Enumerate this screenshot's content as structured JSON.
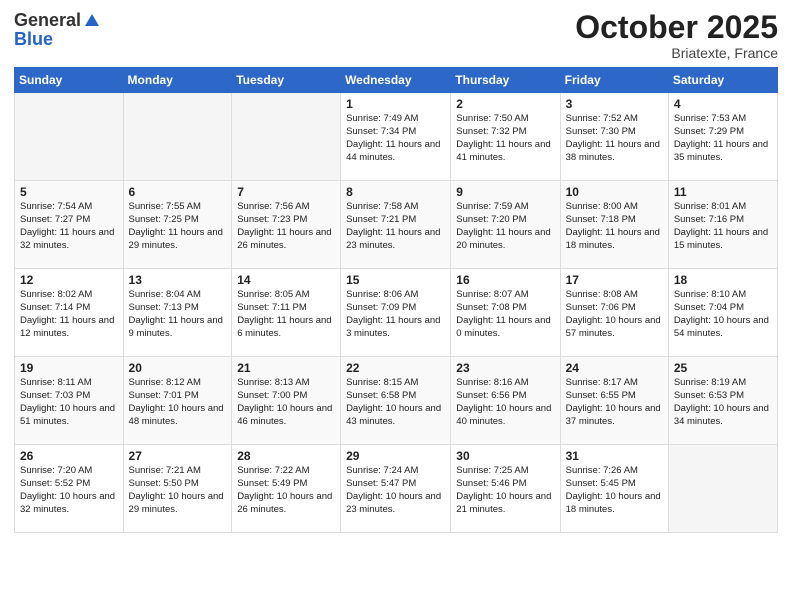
{
  "header": {
    "logo_general": "General",
    "logo_blue": "Blue",
    "month_title": "October 2025",
    "location": "Briatexte, France"
  },
  "days_of_week": [
    "Sunday",
    "Monday",
    "Tuesday",
    "Wednesday",
    "Thursday",
    "Friday",
    "Saturday"
  ],
  "weeks": [
    [
      {
        "day": "",
        "empty": true
      },
      {
        "day": "",
        "empty": true
      },
      {
        "day": "",
        "empty": true
      },
      {
        "day": "1",
        "sunrise": "7:49 AM",
        "sunset": "7:34 PM",
        "daylight": "11 hours and 44 minutes."
      },
      {
        "day": "2",
        "sunrise": "7:50 AM",
        "sunset": "7:32 PM",
        "daylight": "11 hours and 41 minutes."
      },
      {
        "day": "3",
        "sunrise": "7:52 AM",
        "sunset": "7:30 PM",
        "daylight": "11 hours and 38 minutes."
      },
      {
        "day": "4",
        "sunrise": "7:53 AM",
        "sunset": "7:29 PM",
        "daylight": "11 hours and 35 minutes."
      }
    ],
    [
      {
        "day": "5",
        "sunrise": "7:54 AM",
        "sunset": "7:27 PM",
        "daylight": "11 hours and 32 minutes."
      },
      {
        "day": "6",
        "sunrise": "7:55 AM",
        "sunset": "7:25 PM",
        "daylight": "11 hours and 29 minutes."
      },
      {
        "day": "7",
        "sunrise": "7:56 AM",
        "sunset": "7:23 PM",
        "daylight": "11 hours and 26 minutes."
      },
      {
        "day": "8",
        "sunrise": "7:58 AM",
        "sunset": "7:21 PM",
        "daylight": "11 hours and 23 minutes."
      },
      {
        "day": "9",
        "sunrise": "7:59 AM",
        "sunset": "7:20 PM",
        "daylight": "11 hours and 20 minutes."
      },
      {
        "day": "10",
        "sunrise": "8:00 AM",
        "sunset": "7:18 PM",
        "daylight": "11 hours and 18 minutes."
      },
      {
        "day": "11",
        "sunrise": "8:01 AM",
        "sunset": "7:16 PM",
        "daylight": "11 hours and 15 minutes."
      }
    ],
    [
      {
        "day": "12",
        "sunrise": "8:02 AM",
        "sunset": "7:14 PM",
        "daylight": "11 hours and 12 minutes."
      },
      {
        "day": "13",
        "sunrise": "8:04 AM",
        "sunset": "7:13 PM",
        "daylight": "11 hours and 9 minutes."
      },
      {
        "day": "14",
        "sunrise": "8:05 AM",
        "sunset": "7:11 PM",
        "daylight": "11 hours and 6 minutes."
      },
      {
        "day": "15",
        "sunrise": "8:06 AM",
        "sunset": "7:09 PM",
        "daylight": "11 hours and 3 minutes."
      },
      {
        "day": "16",
        "sunrise": "8:07 AM",
        "sunset": "7:08 PM",
        "daylight": "11 hours and 0 minutes."
      },
      {
        "day": "17",
        "sunrise": "8:08 AM",
        "sunset": "7:06 PM",
        "daylight": "10 hours and 57 minutes."
      },
      {
        "day": "18",
        "sunrise": "8:10 AM",
        "sunset": "7:04 PM",
        "daylight": "10 hours and 54 minutes."
      }
    ],
    [
      {
        "day": "19",
        "sunrise": "8:11 AM",
        "sunset": "7:03 PM",
        "daylight": "10 hours and 51 minutes."
      },
      {
        "day": "20",
        "sunrise": "8:12 AM",
        "sunset": "7:01 PM",
        "daylight": "10 hours and 48 minutes."
      },
      {
        "day": "21",
        "sunrise": "8:13 AM",
        "sunset": "7:00 PM",
        "daylight": "10 hours and 46 minutes."
      },
      {
        "day": "22",
        "sunrise": "8:15 AM",
        "sunset": "6:58 PM",
        "daylight": "10 hours and 43 minutes."
      },
      {
        "day": "23",
        "sunrise": "8:16 AM",
        "sunset": "6:56 PM",
        "daylight": "10 hours and 40 minutes."
      },
      {
        "day": "24",
        "sunrise": "8:17 AM",
        "sunset": "6:55 PM",
        "daylight": "10 hours and 37 minutes."
      },
      {
        "day": "25",
        "sunrise": "8:19 AM",
        "sunset": "6:53 PM",
        "daylight": "10 hours and 34 minutes."
      }
    ],
    [
      {
        "day": "26",
        "sunrise": "7:20 AM",
        "sunset": "5:52 PM",
        "daylight": "10 hours and 32 minutes."
      },
      {
        "day": "27",
        "sunrise": "7:21 AM",
        "sunset": "5:50 PM",
        "daylight": "10 hours and 29 minutes."
      },
      {
        "day": "28",
        "sunrise": "7:22 AM",
        "sunset": "5:49 PM",
        "daylight": "10 hours and 26 minutes."
      },
      {
        "day": "29",
        "sunrise": "7:24 AM",
        "sunset": "5:47 PM",
        "daylight": "10 hours and 23 minutes."
      },
      {
        "day": "30",
        "sunrise": "7:25 AM",
        "sunset": "5:46 PM",
        "daylight": "10 hours and 21 minutes."
      },
      {
        "day": "31",
        "sunrise": "7:26 AM",
        "sunset": "5:45 PM",
        "daylight": "10 hours and 18 minutes."
      },
      {
        "day": "",
        "empty": true
      }
    ]
  ]
}
